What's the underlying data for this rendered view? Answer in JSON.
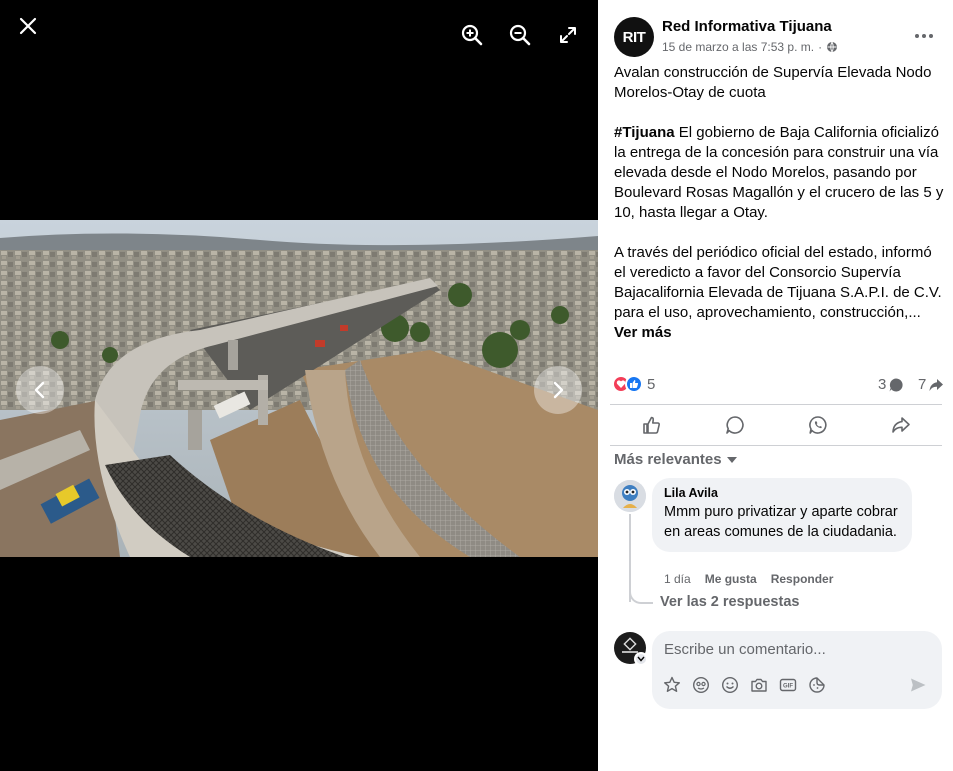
{
  "viewer": {
    "close_icon": "close-icon",
    "zoom_in_icon": "zoom-in-icon",
    "zoom_out_icon": "zoom-out-icon",
    "fullscreen_icon": "fullscreen-icon",
    "prev_icon": "chevron-left-icon",
    "next_icon": "chevron-right-icon"
  },
  "post": {
    "page_name": "Red Informativa Tijuana",
    "avatar_text": "RIT",
    "timestamp": "15 de marzo a las 7:53 p. m.",
    "separator": "·",
    "privacy_icon": "globe-icon",
    "title_line": "Avalan construcción de Supervía Elevada Nodo Morelos-Otay de cuota",
    "hashtag": "#Tijuana",
    "paragraph_1": " El gobierno de Baja California oficializó la entrega de la concesión para construir una vía elevada desde el Nodo Morelos, pasando por Boulevard Rosas Magallón y el crucero de las 5 y 10, hasta llegar a Otay.",
    "paragraph_2": "A través del periódico oficial del estado, informó el veredicto a favor del Consorcio Supervía Bajacalifornia Elevada de Tijuana S.A.P.I. de C.V. para el uso, aprovechamiento, construcción,...",
    "see_more": "Ver más"
  },
  "stats": {
    "reactions_count": "5",
    "comments_count": "3",
    "shares_count": "7"
  },
  "actions": [
    "like",
    "comment",
    "whatsapp",
    "share"
  ],
  "sort_label": "Más relevantes",
  "comment": {
    "author": "Lila Avila",
    "text": "Mmm puro privatizar y aparte cobrar en areas comunes de la ciudadania.",
    "time": "1 día",
    "like_label": "Me gusta",
    "reply_label": "Responder",
    "view_replies": "Ver las 2 respuestas"
  },
  "composer": {
    "placeholder": "Escribe un comentario...",
    "tools": [
      "sticker-icon",
      "avatar-sticker-icon",
      "emoji-icon",
      "camera-icon",
      "gif-icon",
      "sticker-face-icon"
    ],
    "send_icon": "send-icon"
  },
  "colors": {
    "viewer_bg": "#000000",
    "text_primary": "#050505",
    "text_secondary": "#65676b",
    "divider": "#ced0d4",
    "bubble": "#f0f2f5",
    "like_blue": "#1877f2",
    "love_red": "#f33e58"
  }
}
